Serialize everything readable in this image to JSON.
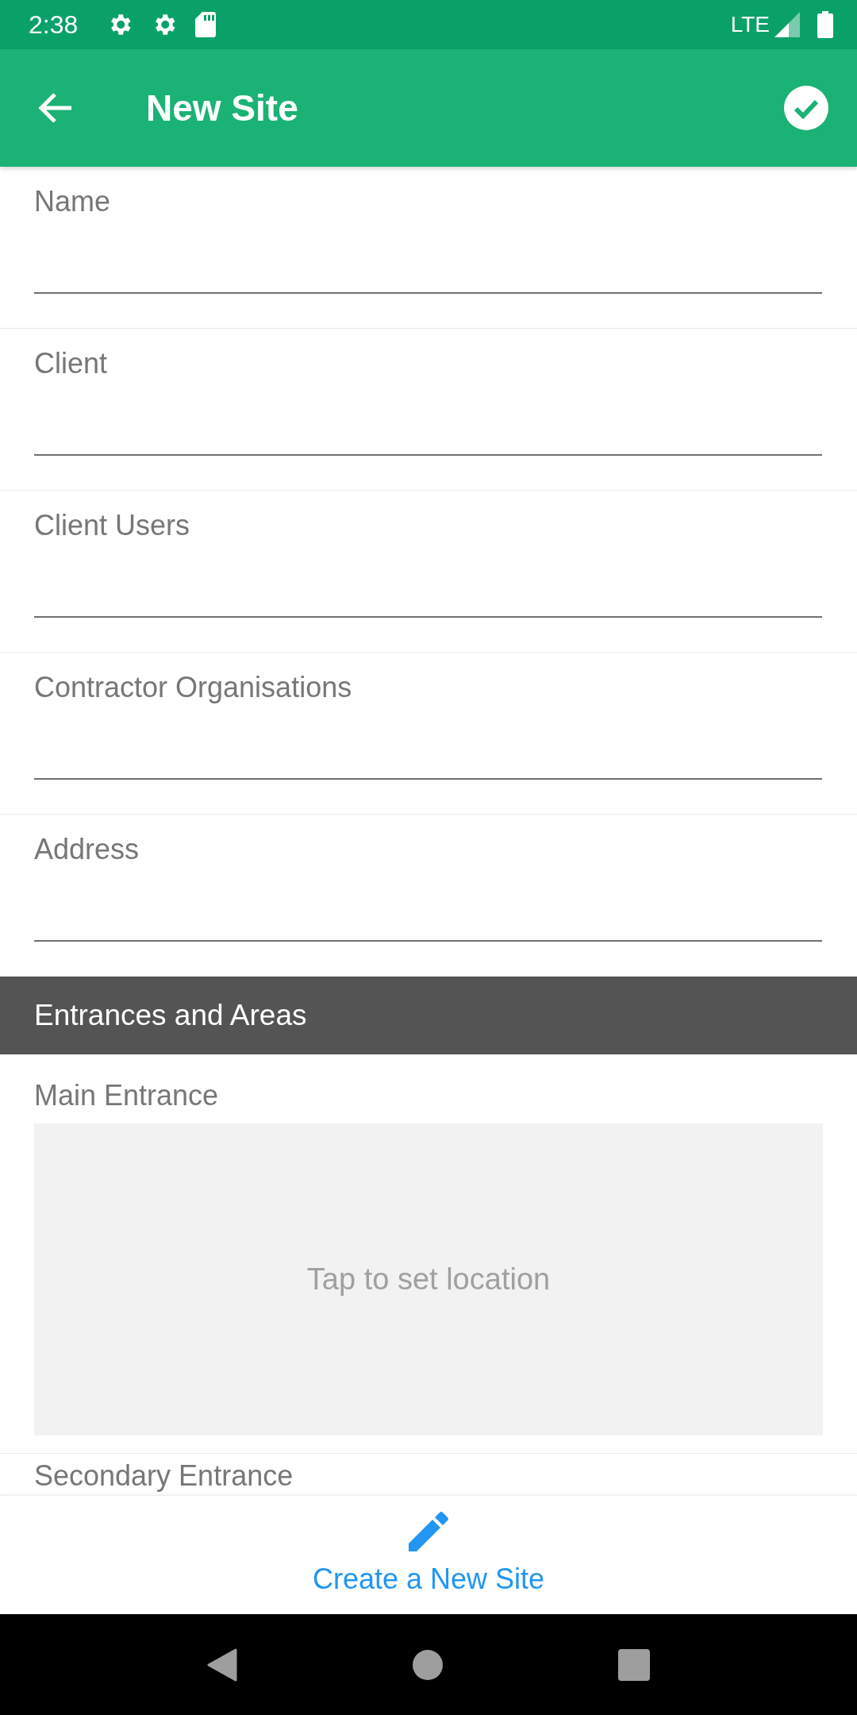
{
  "status_bar": {
    "time": "2:38",
    "network": "LTE"
  },
  "toolbar": {
    "title": "New Site"
  },
  "fields": [
    {
      "label": "Name"
    },
    {
      "label": "Client"
    },
    {
      "label": "Client Users"
    },
    {
      "label": "Contractor Organisations"
    },
    {
      "label": "Address"
    }
  ],
  "section": {
    "title": "Entrances and Areas"
  },
  "locations": [
    {
      "label": "Main Entrance",
      "placeholder": "Tap to set location"
    },
    {
      "label": "Secondary Entrance"
    }
  ],
  "bottom_action": {
    "label": "Create a New Site"
  }
}
